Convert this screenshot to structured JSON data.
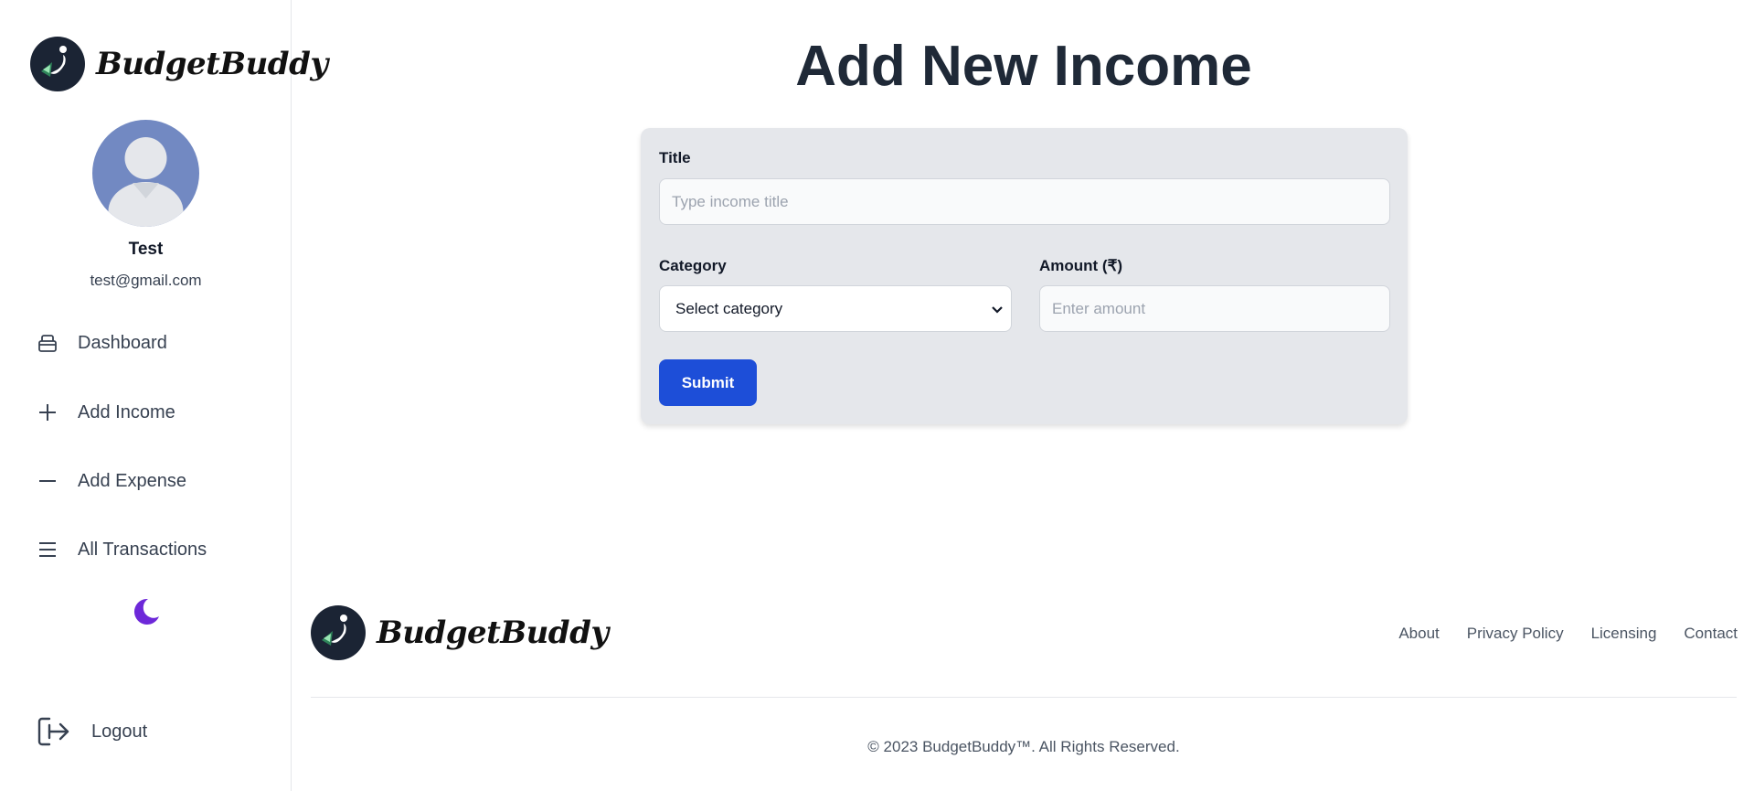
{
  "app": {
    "brand_name": "BudgetBuddy"
  },
  "user": {
    "name": "Test",
    "email": "test@gmail.com"
  },
  "sidebar": {
    "items": [
      {
        "label": "Dashboard",
        "icon": "dashboard-icon"
      },
      {
        "label": "Add Income",
        "icon": "plus-icon"
      },
      {
        "label": "Add Expense",
        "icon": "minus-icon"
      },
      {
        "label": "All Transactions",
        "icon": "menu-icon"
      }
    ],
    "theme_toggle_icon": "moon-icon",
    "logout_label": "Logout",
    "logout_icon": "logout-icon"
  },
  "main": {
    "title": "Add New Income",
    "form": {
      "title_label": "Title",
      "title_placeholder": "Type income title",
      "title_value": "",
      "category_label": "Category",
      "category_selected": "Select category",
      "amount_label": "Amount (₹)",
      "amount_placeholder": "Enter amount",
      "amount_value": "",
      "submit_label": "Submit"
    }
  },
  "footer": {
    "links": [
      "About",
      "Privacy Policy",
      "Licensing",
      "Contact"
    ],
    "copyright": "© 2023 BudgetBuddy™. All Rights Reserved."
  },
  "colors": {
    "primary_button": "#1d4ed8",
    "form_background": "#e5e7eb",
    "avatar_background": "#7289c2",
    "moon_icon": "#6d28d9",
    "logo_background": "#1b2434"
  }
}
